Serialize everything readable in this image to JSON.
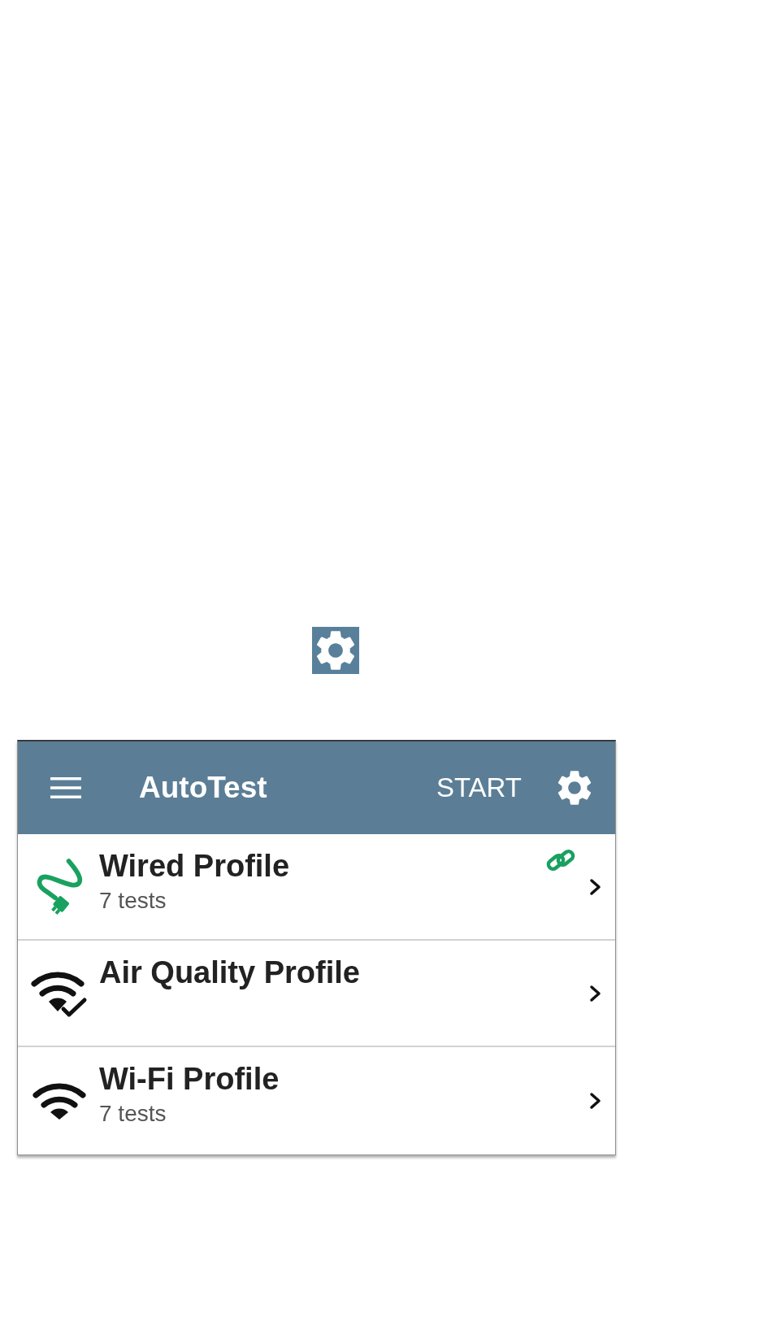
{
  "app_bar": {
    "title": "AutoTest",
    "action": "START"
  },
  "profiles": [
    {
      "kind": "wired",
      "title": "Wired Profile",
      "subtitle": "7 tests",
      "linked": true
    },
    {
      "kind": "air_quality",
      "title": "Air Quality Profile",
      "linked": false
    },
    {
      "kind": "wifi",
      "title": "Wi-Fi Profile",
      "subtitle": "7 tests",
      "linked": false
    }
  ]
}
